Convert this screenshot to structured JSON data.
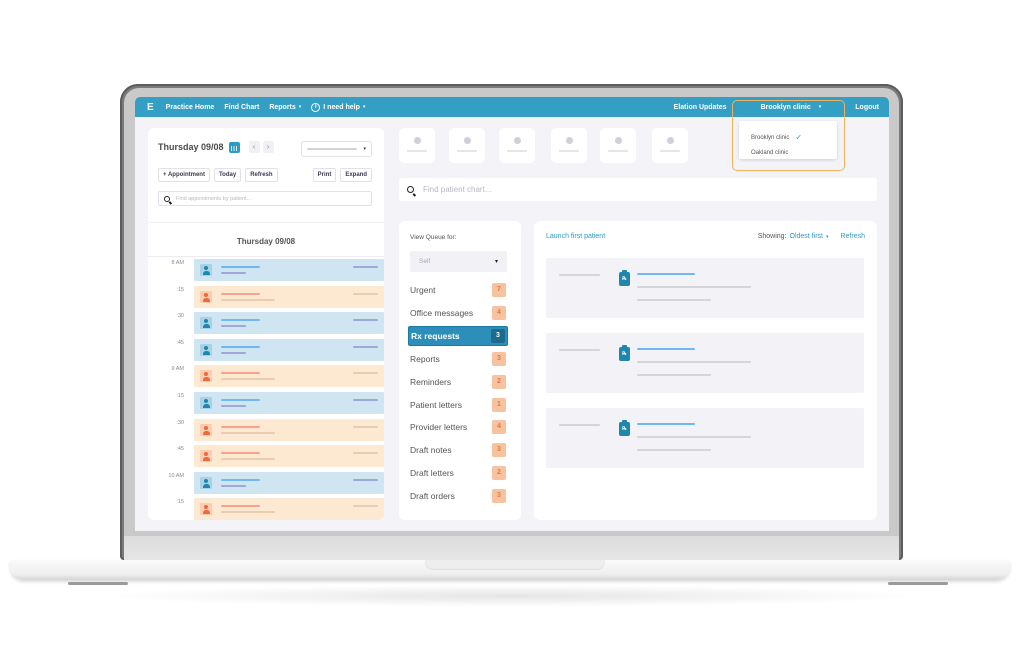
{
  "topbar": {
    "logo": "E",
    "nav": [
      {
        "label": "Practice Home"
      },
      {
        "label": "Find Chart"
      },
      {
        "label": "Reports",
        "has_caret": true
      },
      {
        "label": "I need help",
        "has_caret": true,
        "icon": "info-icon"
      }
    ],
    "updates_label": "Elation Updates",
    "clinic_selected": "Brooklyn clinic",
    "logout_label": "Logout",
    "caret": "▾"
  },
  "clinic_menu": {
    "options": [
      {
        "label": "Brooklyn clinic",
        "selected": true
      },
      {
        "label": "Oakland clinic",
        "selected": false
      }
    ],
    "check_glyph": "✓"
  },
  "schedule": {
    "date_label": "Thursday 09/08",
    "prev_glyph": "‹",
    "next_glyph": "›",
    "provider_select_caret": "▾",
    "actions": {
      "add_appointment": "+ Appointment",
      "today": "Today",
      "refresh": "Refresh",
      "print": "Print",
      "expand": "Expand"
    },
    "search_placeholder": "Find appointments by patient...",
    "day_title": "Thursday 09/08",
    "slots": [
      {
        "time": "8 AM",
        "status": "blue"
      },
      {
        "time": ":15",
        "status": "orange"
      },
      {
        "time": ":30",
        "status": "blue"
      },
      {
        "time": ":45",
        "status": "blue"
      },
      {
        "time": "9 AM",
        "status": "orange"
      },
      {
        "time": ":15",
        "status": "blue"
      },
      {
        "time": ":30",
        "status": "orange"
      },
      {
        "time": ":45",
        "status": "orange"
      },
      {
        "time": "10 AM",
        "status": "blue"
      },
      {
        "time": ":15",
        "status": "orange"
      }
    ]
  },
  "chart_search": {
    "placeholder": "Find patient chart..."
  },
  "queue": {
    "view_label": "View Queue for:",
    "select_value": "Self",
    "select_caret": "▾",
    "items": [
      {
        "label": "Urgent",
        "count": "7",
        "active": false
      },
      {
        "label": "Office messages",
        "count": "4",
        "active": false
      },
      {
        "label": "Rx requests",
        "count": "3",
        "active": true
      },
      {
        "label": "Reports",
        "count": "3",
        "active": false
      },
      {
        "label": "Reminders",
        "count": "2",
        "active": false
      },
      {
        "label": "Patient letters",
        "count": "1",
        "active": false
      },
      {
        "label": "Provider letters",
        "count": "4",
        "active": false
      },
      {
        "label": "Draft notes",
        "count": "3",
        "active": false
      },
      {
        "label": "Draft letters",
        "count": "2",
        "active": false
      },
      {
        "label": "Draft orders",
        "count": "3",
        "active": false
      }
    ]
  },
  "results": {
    "launch_label": "Launch first patient",
    "showing_label": "Showing:",
    "sort_value": "Oldest first",
    "sort_caret": "▾",
    "refresh_label": "Refresh",
    "rx_glyph": "℞",
    "card_count": 3
  }
}
